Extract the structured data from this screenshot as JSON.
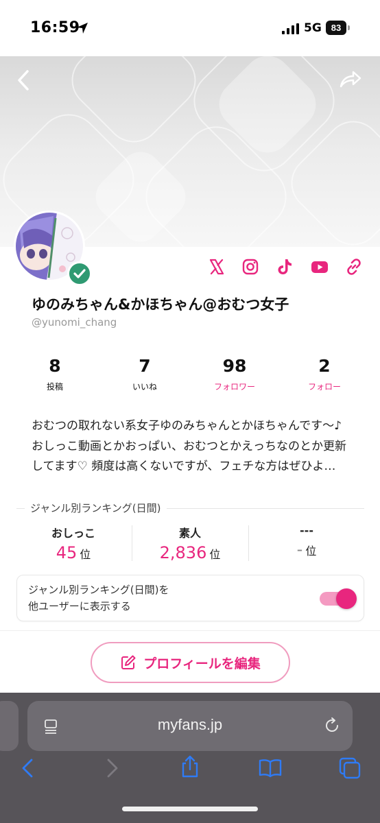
{
  "status_bar": {
    "time": "16:59",
    "network": "5G",
    "battery": "83"
  },
  "profile": {
    "display_name": "ゆのみちゃん&かほちゃん@おむつ女子",
    "handle": "@yunomi_chang",
    "verified": true,
    "social_links": [
      "x-icon",
      "instagram-icon",
      "tiktok-icon",
      "youtube-icon",
      "link-icon"
    ]
  },
  "stats": [
    {
      "value": "8",
      "label": "投稿"
    },
    {
      "value": "7",
      "label": "いいね"
    },
    {
      "value": "98",
      "label": "フォロワー"
    },
    {
      "value": "2",
      "label": "フォロー"
    }
  ],
  "bio": {
    "lines": [
      "おむつの取れない系女子ゆのみちゃんとかほちゃんです〜♪",
      "おしっこ動画とかおっぱい、おむつとかえっちなのとか更新",
      "してます♡ 頻度は高くないですが、フェチな方はぜひよ…"
    ]
  },
  "ranking": {
    "title": "ジャンル別ランキング(日間)",
    "items": [
      {
        "genre": "おしっこ",
        "rank": "45",
        "suffix": "位"
      },
      {
        "genre": "素人",
        "rank": "2,836",
        "suffix": "位"
      },
      {
        "genre": "---",
        "rank": "-",
        "suffix": "位"
      }
    ],
    "toggle_label_line1": "ジャンル別ランキング(日間)を",
    "toggle_label_line2": "他ユーザーに表示する",
    "toggle_on": true
  },
  "edit_button": {
    "label": "プロフィールを編集"
  },
  "browser": {
    "url": "myfans.jp"
  },
  "colors": {
    "accent": "#e8267e",
    "verified": "#2f9a72",
    "browser_bg": "#575459"
  }
}
